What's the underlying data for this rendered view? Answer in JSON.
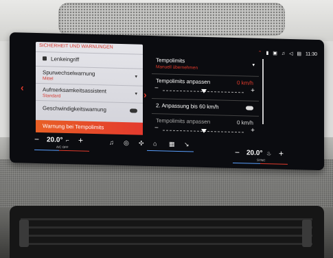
{
  "left_panel": {
    "title": "SICHERHEIT UND WARNUNGEN",
    "items": [
      {
        "label": "Lenkeingriff",
        "sub": ""
      },
      {
        "label": "Spurwechselwarnung",
        "sub": "Mittel"
      },
      {
        "label": "Aufmerksamkeitsassistent",
        "sub": "Standard"
      },
      {
        "label": "Geschwindigkeitswarnung",
        "sub": ""
      }
    ],
    "active_item": "Warnung bei Tempolimits"
  },
  "right_panel": {
    "title": "Tempolimits",
    "subtitle": "Manuell übernehmen",
    "adjust_label": "Tempolimits anpassen",
    "adjust_value": "0 km/h",
    "second_label": "2. Anpassung bis 60 km/h",
    "adjust_label_2": "Tempolimits anpassen",
    "adjust_value_2": "0 km/h",
    "minus": "−",
    "plus": "+"
  },
  "status": {
    "time": "11:30"
  },
  "climate": {
    "left_temp": "20.0°",
    "right_temp": "20.0°",
    "left_caption": "A/C OFF",
    "right_caption": "SYNC",
    "minus": "−",
    "plus": "+"
  },
  "dock": {
    "icons": [
      "music-note-icon",
      "steering-icon",
      "fan-icon",
      "home-icon",
      "apps-icon",
      "phone-icon"
    ]
  },
  "colors": {
    "accent": "#e53b2c",
    "active_gradient_start": "#e85f25"
  }
}
